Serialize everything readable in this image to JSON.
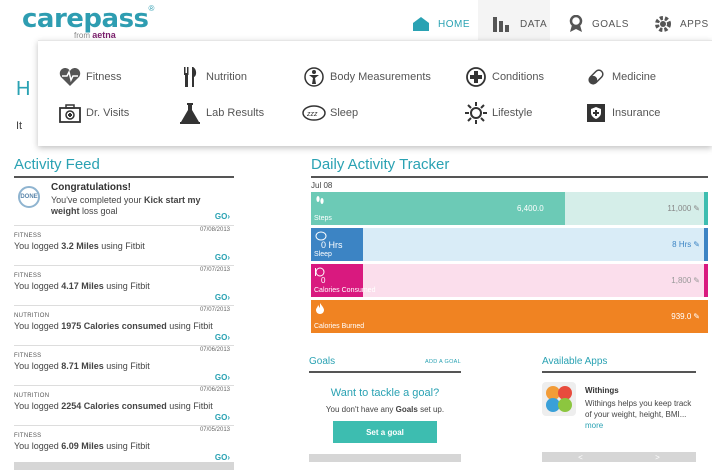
{
  "brand": {
    "name": "carepass",
    "tm": "®",
    "from": "from",
    "partner": "aetna"
  },
  "nav": [
    {
      "label": "HOME",
      "icon": "home-icon"
    },
    {
      "label": "DATA",
      "icon": "bar-chart-icon"
    },
    {
      "label": "GOALS",
      "icon": "ribbon-icon"
    },
    {
      "label": "APPS",
      "icon": "gear-icon"
    }
  ],
  "data_menu": [
    {
      "label": "Fitness",
      "icon": "heartbeat-icon"
    },
    {
      "label": "Nutrition",
      "icon": "fork-knife-icon"
    },
    {
      "label": "Body Measurements",
      "icon": "body-icon"
    },
    {
      "label": "Conditions",
      "icon": "medical-cross-icon"
    },
    {
      "label": "Medicine",
      "icon": "pill-icon"
    },
    {
      "label": "Dr. Visits",
      "icon": "medical-bag-icon"
    },
    {
      "label": "Lab Results",
      "icon": "flask-icon"
    },
    {
      "label": "Sleep",
      "icon": "sleep-icon"
    },
    {
      "label": "Lifestyle",
      "icon": "sun-icon"
    },
    {
      "label": "Insurance",
      "icon": "insurance-card-icon"
    }
  ],
  "hidden_header": {
    "h": "H",
    "it": "It"
  },
  "feed": {
    "title": "Activity Feed",
    "congrats": {
      "badge": "DONE",
      "title": "Congratulations!",
      "text_pre": "You've completed your ",
      "text_bold": "Kick start my weight",
      "text_post": "loss goal",
      "go": "GO"
    },
    "entries": [
      {
        "category": "FITNESS",
        "date": "07/08/2013",
        "pre": "You logged ",
        "bold": "3.2 Miles",
        "post": " using Fitbit",
        "go": "GO"
      },
      {
        "category": "FITNESS",
        "date": "07/07/2013",
        "pre": "You logged ",
        "bold": "4.17 Miles",
        "post": " using Fitbit",
        "go": "GO"
      },
      {
        "category": "NUTRITION",
        "date": "07/07/2013",
        "pre": "You logged ",
        "bold": "1975 Calories consumed",
        "post": " using Fitbit",
        "go": "GO"
      },
      {
        "category": "FITNESS",
        "date": "07/06/2013",
        "pre": "You logged ",
        "bold": "8.71 Miles",
        "post": " using Fitbit",
        "go": "GO"
      },
      {
        "category": "NUTRITION",
        "date": "07/06/2013",
        "pre": "You logged ",
        "bold": "2254 Calories consumed",
        "post": " using Fitbit",
        "go": "GO"
      },
      {
        "category": "FITNESS",
        "date": "07/05/2013",
        "pre": "You logged ",
        "bold": "6.09 Miles",
        "post": " using Fitbit",
        "go": "GO"
      }
    ]
  },
  "tracker": {
    "title": "Daily Activity Tracker",
    "date": "Jul 08",
    "rows": [
      {
        "name": "steps",
        "label": "Steps",
        "value": "6,400.0",
        "goal": "11,000",
        "fraction": 0.64,
        "color": "#6ccab6",
        "rest": "#d5eee9",
        "text": "#888",
        "endcap": "#3dbdb0"
      },
      {
        "name": "sleep",
        "label": "Sleep",
        "value": "0 Hrs",
        "goal": "8 Hrs",
        "fraction": 0.13,
        "color": "#3c84c4",
        "rest": "#d9ecf7",
        "text": "#3c84c4",
        "endcap": "#3c84c4"
      },
      {
        "name": "calories-consumed",
        "label": "Calories Consumed",
        "value": "0",
        "goal": "1,800",
        "fraction": 0.13,
        "color": "#d9197f",
        "rest": "#fbdeec",
        "text": "#999",
        "endcap": "#d9197f"
      },
      {
        "name": "calories-burned",
        "label": "Calories Burned",
        "value": "",
        "goal": "939.0",
        "fraction": 1.0,
        "color": "#f08322",
        "rest": "#f08322",
        "text": "#fff",
        "endcap": "#f08322"
      }
    ]
  },
  "goals": {
    "title": "Goals",
    "add": "ADD A GOAL",
    "question": "Want to tackle a goal?",
    "none_pre": "You don't have any ",
    "none_bold": "Goals",
    "none_post": " set up.",
    "button": "Set a goal"
  },
  "apps": {
    "title": "Available Apps",
    "app_name": "Withings",
    "desc": "Withings helps you keep track of your weight, height, BMI...",
    "more": "more",
    "prev": "<",
    "next": ">"
  }
}
